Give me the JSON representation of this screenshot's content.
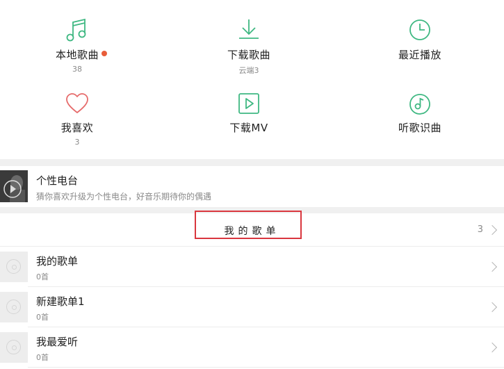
{
  "grid": {
    "local": {
      "label": "本地歌曲",
      "sub": "38"
    },
    "download": {
      "label": "下载歌曲",
      "sub": "云端3"
    },
    "recent": {
      "label": "最近播放"
    },
    "favorites": {
      "label": "我喜欢",
      "sub": "3"
    },
    "mv": {
      "label": "下载MV"
    },
    "identify": {
      "label": "听歌识曲"
    }
  },
  "radio": {
    "title": "个性电台",
    "description": "猜你喜欢升级为个性电台，好音乐期待你的偶遇"
  },
  "playlists_section": {
    "title": "我的歌单",
    "count": "3"
  },
  "playlists": [
    {
      "name": "我的歌单",
      "count": "0首"
    },
    {
      "name": "新建歌单1",
      "count": "0首"
    },
    {
      "name": "我最爱听",
      "count": "0首"
    }
  ],
  "colors": {
    "accent_green": "#3fb882",
    "heart_red": "#e66b6b",
    "badge_dot": "#e85d3a",
    "highlight_box": "#d9363e"
  }
}
